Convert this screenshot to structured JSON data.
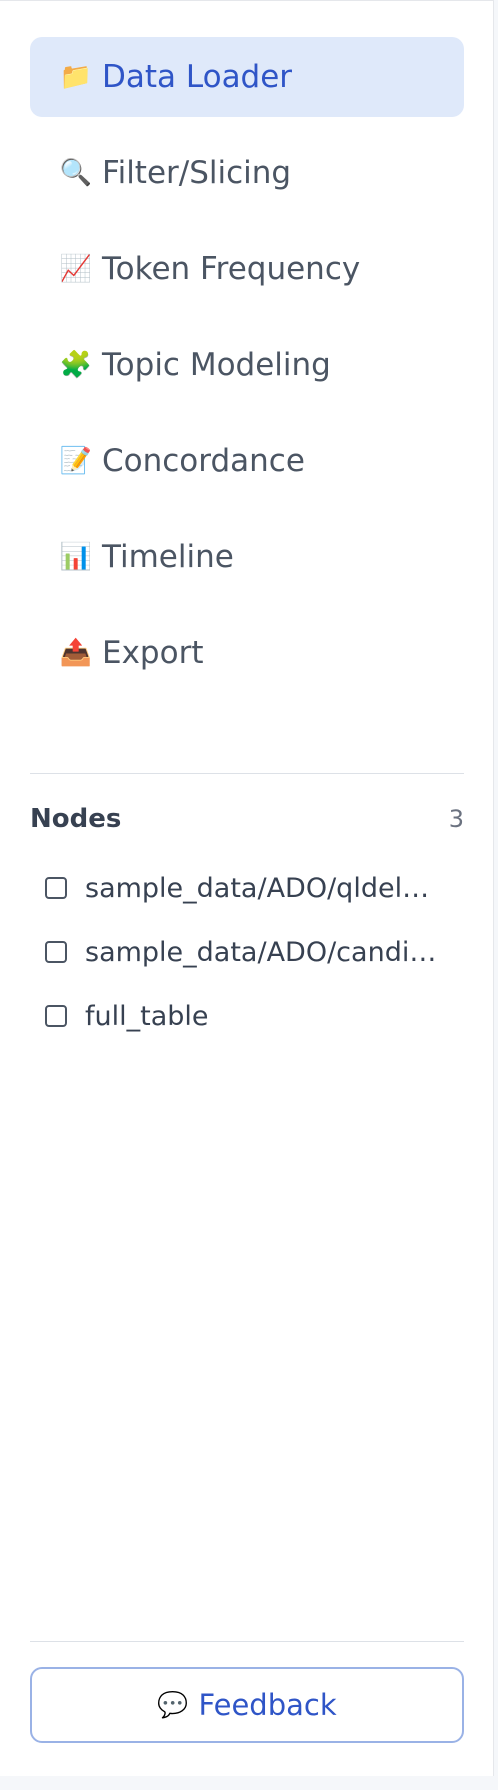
{
  "sidebar": {
    "nav": [
      {
        "icon": "folder-icon",
        "glyph": "📁",
        "label": "Data Loader",
        "active": true
      },
      {
        "icon": "search-icon",
        "glyph": "🔍",
        "label": "Filter/Slicing",
        "active": false
      },
      {
        "icon": "chart-up-icon",
        "glyph": "📈",
        "label": "Token Frequency",
        "active": false
      },
      {
        "icon": "puzzle-icon",
        "glyph": "🧩",
        "label": "Topic Modeling",
        "active": false
      },
      {
        "icon": "memo-icon",
        "glyph": "📝",
        "label": "Concordance",
        "active": false
      },
      {
        "icon": "bar-chart-icon",
        "glyph": "📊",
        "label": "Timeline",
        "active": false
      },
      {
        "icon": "export-tray-icon",
        "glyph": "📤",
        "label": "Export",
        "active": false
      }
    ],
    "nodes": {
      "title": "Nodes",
      "count": "3",
      "items": [
        {
          "label": "sample_data/ADO/qldele…",
          "checked": false
        },
        {
          "label": "sample_data/ADO/candid…",
          "checked": false
        },
        {
          "label": "full_table",
          "checked": false
        }
      ]
    },
    "feedback": {
      "icon": "speech-bubble-icon",
      "glyph": "💬",
      "label": "Feedback"
    },
    "colors": {
      "accent": "#2f55c7",
      "active_bg": "#dfe9fa"
    }
  }
}
